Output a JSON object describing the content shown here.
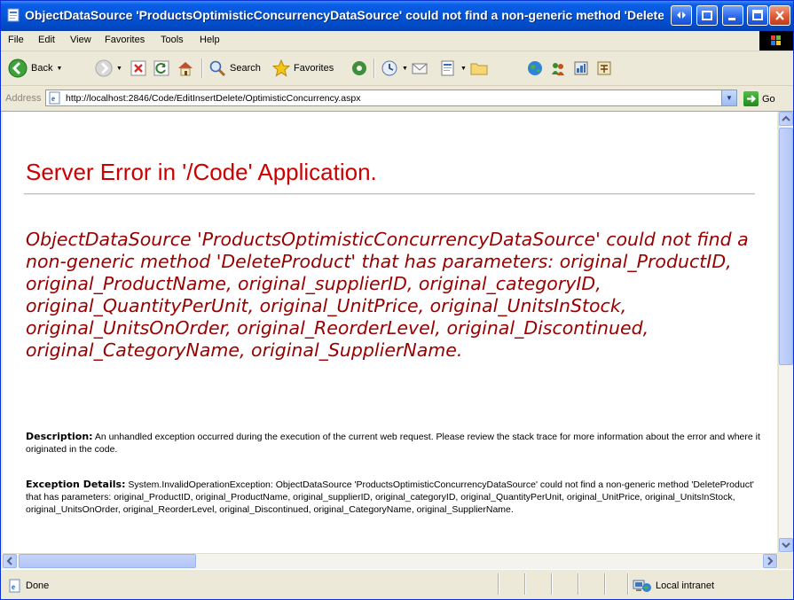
{
  "window": {
    "title": "ObjectDataSource 'ProductsOptimisticConcurrencyDataSource' could not find a non-generic method 'DeleteProduct' that has parameters: original_ProductID, original_ProductName, original_supplierID, original_categoryID, original_QuantityPerUnit, original_UnitPrice, original_UnitsInStock, original_UnitsOnOrder, original_ReorderLevel, original_Discontinued, original_CategoryName, original_SupplierName. - Microsoft Internet Explorer"
  },
  "menu": {
    "file": "File",
    "edit": "Edit",
    "view": "View",
    "favorites": "Favorites",
    "tools": "Tools",
    "help": "Help"
  },
  "toolbar": {
    "back": "Back",
    "search": "Search",
    "favorites": "Favorites"
  },
  "address": {
    "label": "Address",
    "url": "http://localhost:2846/Code/EditInsertDelete/OptimisticConcurrency.aspx",
    "go": "Go"
  },
  "page": {
    "heading": "Server Error in '/Code' Application.",
    "error_message": "ObjectDataSource 'ProductsOptimisticConcurrencyDataSource' could not find a non-generic method 'DeleteProduct' that has parameters: original_ProductID, original_ProductName, original_supplierID, original_categoryID, original_QuantityPerUnit, original_UnitPrice, original_UnitsInStock, original_UnitsOnOrder, original_ReorderLevel, original_Discontinued, original_CategoryName, original_SupplierName.",
    "description_label": "Description:",
    "description_text": " An unhandled exception occurred during the execution of the current web request. Please review the stack trace for more information about the error and where it originated in the code.",
    "exception_label": "Exception Details:",
    "exception_text": " System.InvalidOperationException: ObjectDataSource 'ProductsOptimisticConcurrencyDataSource' could not find a non-generic method 'DeleteProduct' that has parameters: original_ProductID, original_ProductName, original_supplierID, original_categoryID, original_QuantityPerUnit, original_UnitPrice, original_UnitsInStock, original_UnitsOnOrder, original_ReorderLevel, original_Discontinued, original_CategoryName, original_SupplierName."
  },
  "status": {
    "left": "Done",
    "zone": "Local intranet"
  },
  "colors": {
    "heading_red": "#cc0000",
    "error_maroon": "#990000",
    "titlebar_blue": "#0356d6"
  }
}
